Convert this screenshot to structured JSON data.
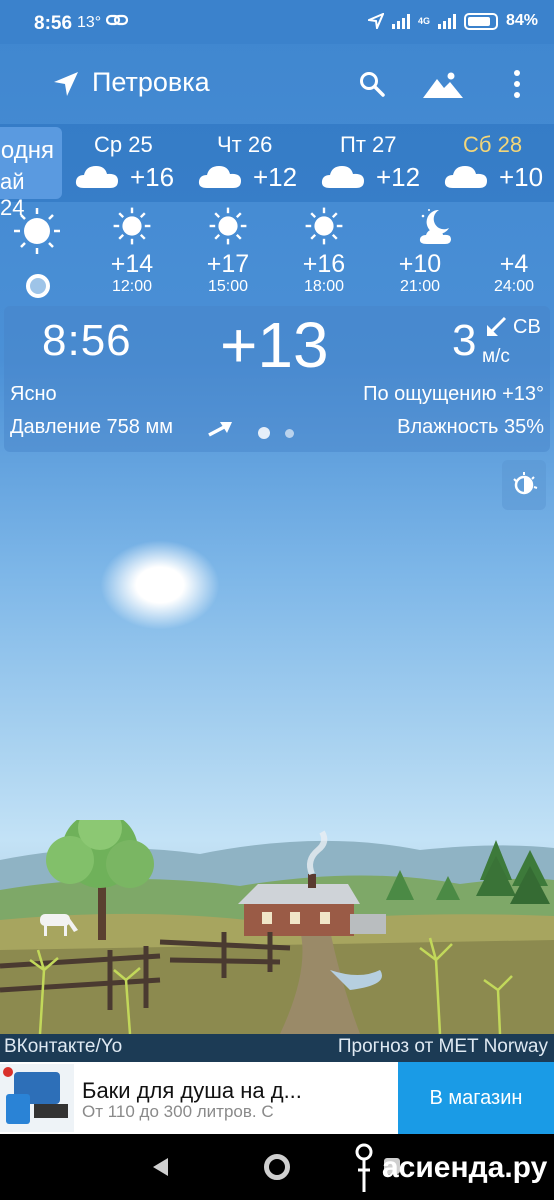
{
  "status": {
    "time": "8:56",
    "temp": "13°",
    "net": "4G",
    "battery": "84%"
  },
  "header": {
    "location": "Петровка",
    "icons": [
      "location-arrow-icon",
      "search-icon",
      "landscape-icon",
      "more-vert-icon"
    ]
  },
  "days": {
    "today_line1": "одня",
    "today_line2": "ай 24",
    "items": [
      {
        "label": "Ср 25",
        "temp": "+16",
        "color": "#ffffff"
      },
      {
        "label": "Чт 26",
        "temp": "+12",
        "color": "#ffffff"
      },
      {
        "label": "Пт 27",
        "temp": "+12",
        "color": "#ffffff"
      },
      {
        "label": "Сб 28",
        "temp": "+10",
        "color": "#f3d679"
      }
    ]
  },
  "hourly": [
    {
      "icon": "sun-icon",
      "temp": "+14",
      "time": "12:00"
    },
    {
      "icon": "sun-icon",
      "temp": "+17",
      "time": "15:00"
    },
    {
      "icon": "sun-icon",
      "temp": "+16",
      "time": "18:00"
    },
    {
      "icon": "moon-cloud-icon",
      "temp": "+10",
      "time": "21:00"
    },
    {
      "icon": "none",
      "temp": "+4",
      "time": "24:00"
    }
  ],
  "current": {
    "time": "8:56",
    "temp": "+13",
    "wind_speed": "3",
    "wind_unit": "м/с",
    "wind_dir": "СВ",
    "condition": "Ясно",
    "feels_like": "По ощущению +13°",
    "pressure": "Давление 758 мм",
    "humidity": "Влажность 35%"
  },
  "footer": {
    "left": "ВКонтакте/Yo",
    "right": "Прогноз от MET Norway"
  },
  "ad": {
    "title": "Баки для душа на д...",
    "subtitle": "От 110 до 300 литров. С",
    "button": "В магазин"
  },
  "watermark": "асиенда.ру"
}
